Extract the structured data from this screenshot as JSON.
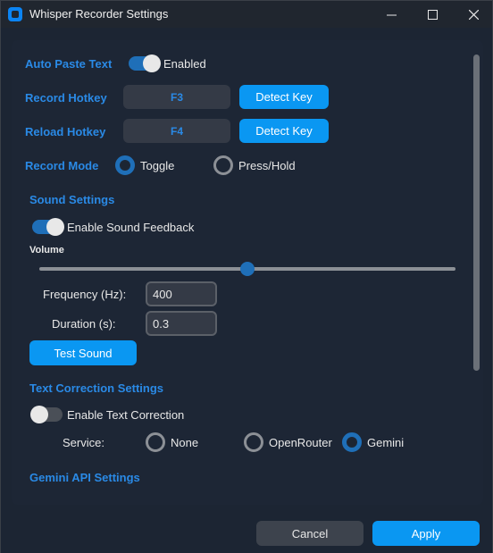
{
  "window": {
    "title": "Whisper Recorder Settings",
    "icons": {
      "app": "app-icon",
      "minimize": "minimize-icon",
      "maximize": "maximize-icon",
      "close": "close-icon"
    }
  },
  "auto_paste": {
    "label": "Auto Paste Text",
    "state_text": "Enabled",
    "enabled": true
  },
  "record_hotkey": {
    "label": "Record Hotkey",
    "key": "F3",
    "button": "Detect Key"
  },
  "reload_hotkey": {
    "label": "Reload Hotkey",
    "key": "F4",
    "button": "Detect Key"
  },
  "record_mode": {
    "label": "Record Mode",
    "options": [
      "Toggle",
      "Press/Hold"
    ],
    "selected": "Toggle"
  },
  "sound": {
    "heading": "Sound Settings",
    "feedback_label": "Enable Sound Feedback",
    "feedback_enabled": true,
    "volume_label": "Volume",
    "volume_value": 0.5,
    "frequency_label": "Frequency (Hz):",
    "frequency_value": "400",
    "duration_label": "Duration (s):",
    "duration_value": "0.3",
    "test_button": "Test Sound"
  },
  "correction": {
    "heading": "Text Correction Settings",
    "enable_label": "Enable Text Correction",
    "enabled": false,
    "service_label": "Service:",
    "options": [
      "None",
      "OpenRouter",
      "Gemini"
    ],
    "selected": "Gemini"
  },
  "gemini": {
    "heading": "Gemini API Settings"
  },
  "footer": {
    "cancel": "Cancel",
    "apply": "Apply"
  },
  "colors": {
    "accent": "#0a97f2",
    "label_blue": "#2a8ae6",
    "background": "#1c2533"
  }
}
